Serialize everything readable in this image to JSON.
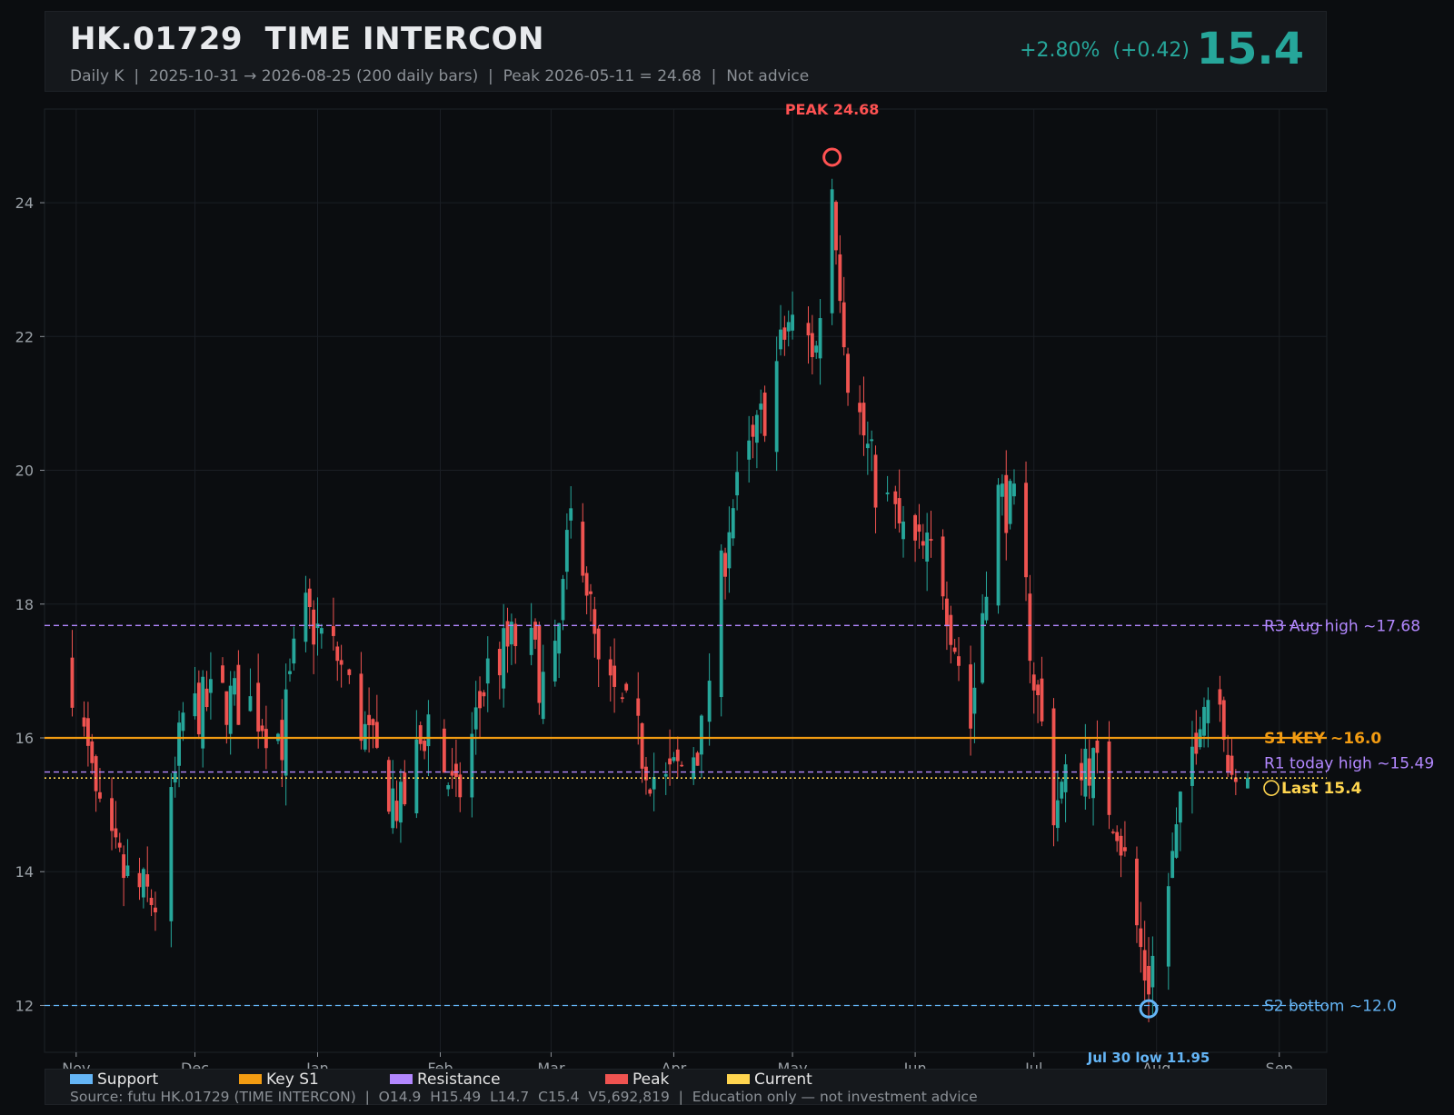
{
  "header": {
    "title": "HK.01729  TIME INTERCON",
    "subtitle": "Daily K  |  2025-10-31 → 2026-08-25 (200 daily bars)  |  Peak 2026-05-11 = 24.68  |  Not advice",
    "change": "+2.80%  (+0.42)",
    "price": "15.4"
  },
  "colors": {
    "up": "#26a69a",
    "down": "#ef5350",
    "support": "#64b5f6",
    "key": "#f39c12",
    "resistance": "#b388ff",
    "peak": "#ff5252",
    "current": "#ffd54f",
    "grid": "#1b1f24"
  },
  "chart_data": {
    "type": "candlestick",
    "ylim": [
      11.3,
      25.4
    ],
    "yticks": [
      12,
      14,
      16,
      18,
      20,
      22,
      24
    ],
    "xticks": [
      {
        "label": "Nov",
        "date": "2025-11-01"
      },
      {
        "label": "Dec",
        "date": "2025-12-01"
      },
      {
        "label": "Jan",
        "date": "2026-01-01"
      },
      {
        "label": "Feb",
        "date": "2026-02-01"
      },
      {
        "label": "Mar",
        "date": "2026-03-01"
      },
      {
        "label": "Apr",
        "date": "2026-04-01"
      },
      {
        "label": "May",
        "date": "2026-05-01"
      },
      {
        "label": "Jun",
        "date": "2026-06-01"
      },
      {
        "label": "Jul",
        "date": "2026-07-01"
      },
      {
        "label": "Aug",
        "date": "2026-08-01"
      },
      {
        "label": "Sep",
        "date": "2026-09-01"
      }
    ],
    "start_date": "2025-10-31",
    "end_date": "2026-08-25",
    "bar_count": 200,
    "anchors": [
      [
        "2025-10-31",
        16.9
      ],
      [
        "2025-11-08",
        14.4
      ],
      [
        "2025-11-15",
        13.8
      ],
      [
        "2025-11-22",
        13.5
      ],
      [
        "2025-11-28",
        16.3
      ],
      [
        "2025-12-07",
        16.6
      ],
      [
        "2025-12-15",
        16.5
      ],
      [
        "2025-12-23",
        16.0
      ],
      [
        "2025-12-28",
        17.9
      ],
      [
        "2026-01-06",
        17.2
      ],
      [
        "2026-01-14",
        15.9
      ],
      [
        "2026-01-22",
        14.9
      ],
      [
        "2026-01-29",
        16.3
      ],
      [
        "2026-02-05",
        15.0
      ],
      [
        "2026-02-13",
        17.0
      ],
      [
        "2026-02-22",
        17.6
      ],
      [
        "2026-03-01",
        16.5
      ],
      [
        "2026-03-07",
        19.8
      ],
      [
        "2026-03-13",
        16.9
      ],
      [
        "2026-03-20",
        16.3
      ],
      [
        "2026-03-29",
        15.2
      ],
      [
        "2026-04-08",
        16.0
      ],
      [
        "2026-04-15",
        19.3
      ],
      [
        "2026-04-22",
        20.5
      ],
      [
        "2026-04-30",
        22.2
      ],
      [
        "2026-05-07",
        21.8
      ],
      [
        "2026-05-11",
        24.3
      ],
      [
        "2026-05-15",
        21.5
      ],
      [
        "2026-05-22",
        19.8
      ],
      [
        "2026-05-31",
        18.8
      ],
      [
        "2026-06-07",
        18.7
      ],
      [
        "2026-06-15",
        16.2
      ],
      [
        "2026-06-21",
        19.7
      ],
      [
        "2026-06-27",
        19.3
      ],
      [
        "2026-07-01",
        16.9
      ],
      [
        "2026-07-06",
        15.0
      ],
      [
        "2026-07-14",
        15.8
      ],
      [
        "2026-07-22",
        14.8
      ],
      [
        "2026-07-29",
        12.5
      ],
      [
        "2026-07-30",
        12.4
      ],
      [
        "2026-08-04",
        13.8
      ],
      [
        "2026-08-12",
        16.5
      ],
      [
        "2026-08-17",
        16.9
      ],
      [
        "2026-08-20",
        15.1
      ],
      [
        "2026-08-25",
        15.4
      ]
    ],
    "levels": [
      {
        "name": "R3",
        "label": "R3 Aug high ~17.68",
        "value": 17.68,
        "role": "resistance",
        "style": "dashed"
      },
      {
        "name": "S1",
        "label": "S1 KEY ~16.0",
        "value": 16.0,
        "role": "key",
        "style": "solid"
      },
      {
        "name": "R1",
        "label": "R1 today high ~15.49",
        "value": 15.49,
        "role": "resistance",
        "style": "dashed"
      },
      {
        "name": "Last",
        "label": "Last 15.4",
        "value": 15.4,
        "role": "current",
        "style": "dotted"
      },
      {
        "name": "S2",
        "label": "S2 bottom ~12.0",
        "value": 12.0,
        "role": "support",
        "style": "dashed"
      }
    ],
    "annotations": [
      {
        "label": "PEAK 24.68",
        "date": "2026-05-11",
        "value": 24.68,
        "role": "peak"
      },
      {
        "label": "Jul 30 low 11.95",
        "date": "2026-07-30",
        "value": 11.95,
        "role": "support"
      }
    ],
    "legend": {
      "position": "bottom",
      "entries": [
        "Support",
        "Key S1",
        "Resistance",
        "Peak",
        "Current"
      ]
    }
  },
  "footer": {
    "legend": [
      {
        "label": "Support",
        "color": "#64b5f6"
      },
      {
        "label": "Key S1",
        "color": "#f39c12"
      },
      {
        "label": "Resistance",
        "color": "#b388ff"
      },
      {
        "label": "Peak",
        "color": "#ef5350"
      },
      {
        "label": "Current",
        "color": "#ffd54f"
      }
    ],
    "source": "Source: futu HK.01729 (TIME INTERCON)  |  O14.9  H15.49  L14.7  C15.4  V5,692,819  |  Education only — not investment advice"
  }
}
